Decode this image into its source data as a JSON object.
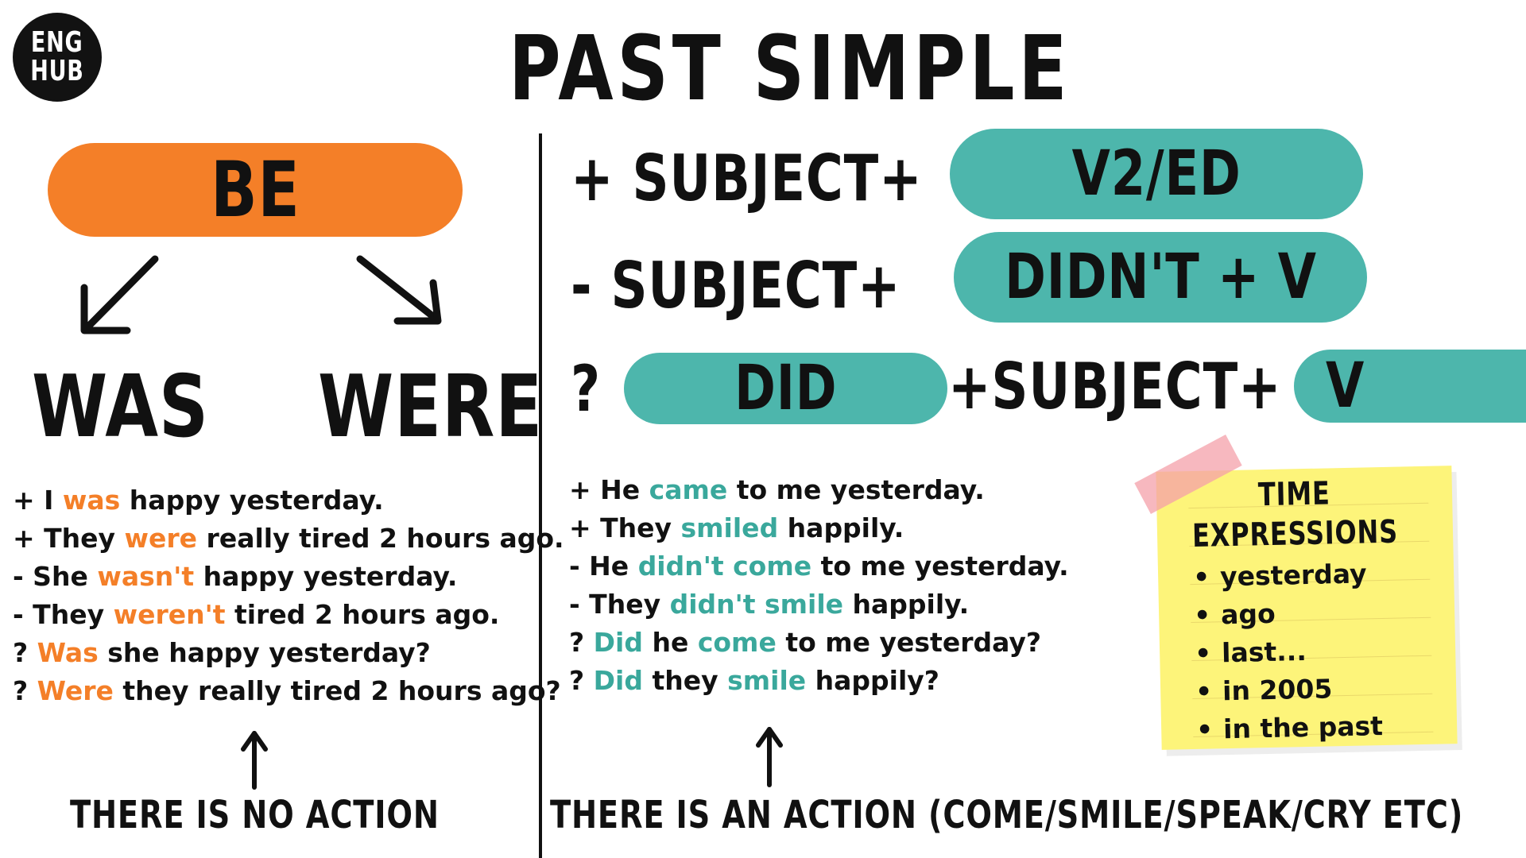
{
  "logo": {
    "line1": "ENG",
    "line2": "HUB"
  },
  "title": "PAST SIMPLE",
  "left": {
    "verb": "BE",
    "forms": [
      "WAS",
      "WERE"
    ],
    "examples": [
      {
        "pre": "+ I ",
        "hl": "was",
        "post": " happy yesterday."
      },
      {
        "pre": "+ They ",
        "hl": "were",
        "post": " really tired 2 hours ago."
      },
      {
        "pre": "- She ",
        "hl": "wasn't",
        "post": " happy yesterday."
      },
      {
        "pre": "- They ",
        "hl": "weren't",
        "post": " tired 2 hours ago."
      },
      {
        "pre": "? ",
        "hl": "Was",
        "post": " she happy yesterday?"
      },
      {
        "pre": "? ",
        "hl": "Were",
        "post": " they really tired 2 hours ago?"
      }
    ],
    "caption": "THERE IS NO ACTION"
  },
  "right": {
    "formulas": {
      "positive": {
        "prefix": "+ SUBJECT+",
        "pill": "V2/ED"
      },
      "negative": {
        "prefix": "- SUBJECT+",
        "pill": "DIDN'T + V"
      },
      "question": {
        "prefix": "?",
        "pill1": "DID",
        "middle": "+SUBJECT+",
        "pill2": "V"
      }
    },
    "examples": [
      [
        {
          "t": "+ He "
        },
        {
          "t": "came",
          "hl": true
        },
        {
          "t": " to me yesterday."
        }
      ],
      [
        {
          "t": "+ They "
        },
        {
          "t": "smiled",
          "hl": true
        },
        {
          "t": " happily."
        }
      ],
      [
        {
          "t": "- He "
        },
        {
          "t": "didn't come",
          "hl": true
        },
        {
          "t": " to me yesterday."
        }
      ],
      [
        {
          "t": "- They "
        },
        {
          "t": "didn't smile",
          "hl": true
        },
        {
          "t": " happily."
        }
      ],
      [
        {
          "t": "? "
        },
        {
          "t": "Did",
          "hl": true
        },
        {
          "t": " he "
        },
        {
          "t": "come",
          "hl": true
        },
        {
          "t": " to me yesterday?"
        }
      ],
      [
        {
          "t": "? "
        },
        {
          "t": "Did",
          "hl": true
        },
        {
          "t": " they "
        },
        {
          "t": "smile",
          "hl": true
        },
        {
          "t": " happily?"
        }
      ]
    ],
    "caption": "THERE IS AN ACTION (COME/SMILE/SPEAK/CRY ETC)"
  },
  "time_expressions": {
    "title_line1": "TIME",
    "title_line2": "EXPRESSIONS",
    "items": [
      "yesterday",
      "ago",
      "last...",
      "in 2005",
      "in the past"
    ]
  },
  "colors": {
    "orange": "#f47f28",
    "teal": "#4db6ac",
    "sticky": "#fdf47a",
    "tape": "#f4a0aa"
  }
}
